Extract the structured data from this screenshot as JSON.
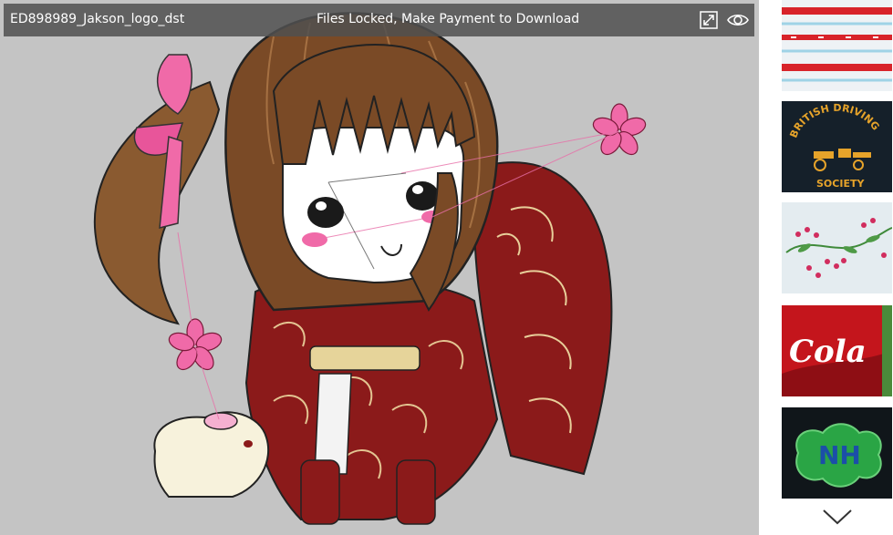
{
  "toolbar": {
    "file_name": "ED898989_Jakson_logo_dst",
    "status": "Files Locked, Make Payment to Download"
  },
  "thumbnails": [
    {
      "name": "red-white-cross-stitch"
    },
    {
      "name": "british-driving-society",
      "text": "BRITISH DRIVING SOCIETY"
    },
    {
      "name": "floral-vine"
    },
    {
      "name": "coca-cola-cap",
      "text": "Cola"
    },
    {
      "name": "nh-logo",
      "text": "NH"
    }
  ],
  "colors": {
    "canvas": "#c4c4c4",
    "topbar": "#505050",
    "accent_red": "#8b1a1a",
    "pink": "#f06aa8",
    "hair": "#7a4a26"
  }
}
